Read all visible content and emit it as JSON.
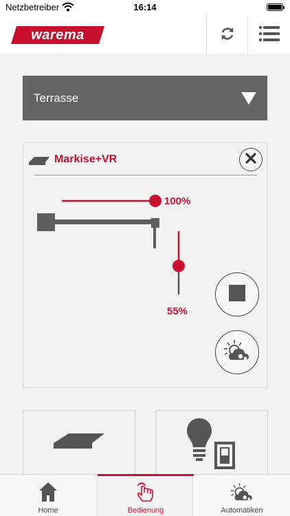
{
  "status_bar": {
    "carrier": "Netzbetreiber",
    "time": "16:14",
    "battery_level": 1.0
  },
  "header": {
    "logo_text": "warema",
    "brand_color": "#c8102e",
    "refresh_icon": "refresh-icon",
    "menu_icon": "menu-icon"
  },
  "room_selector": {
    "selected": "Terrasse",
    "icon": "triangle-down-icon"
  },
  "device_card": {
    "title": "Markise+VR",
    "device_icon": "awning-icon",
    "close_icon": "close-icon",
    "awning_position_percent": 100,
    "awning_label": "100%",
    "valance_position_percent": 55,
    "valance_label": "55%",
    "stop_icon": "stop-icon",
    "automation_icon": "weather-automation-icon"
  },
  "tiles": [
    {
      "icon": "awning-icon"
    },
    {
      "icon": "lightbulb-switch-icon"
    }
  ],
  "tabbar": {
    "tabs": [
      {
        "label": "Home",
        "icon": "home-icon",
        "active": false
      },
      {
        "label": "Bedienung",
        "icon": "touch-hand-icon",
        "active": true
      },
      {
        "label": "Automatiken",
        "icon": "weather-automation-icon",
        "active": false
      }
    ]
  }
}
